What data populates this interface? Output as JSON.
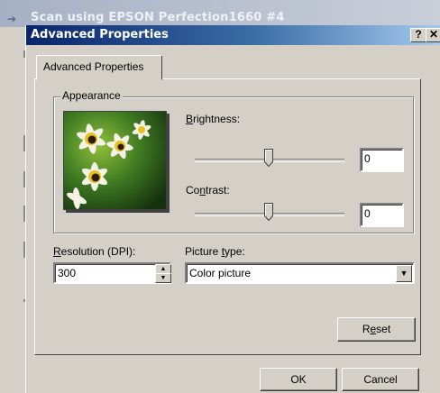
{
  "background_window": {
    "title": "Scan using EPSON Perfection1660 #4"
  },
  "dialog": {
    "title": "Advanced Properties",
    "help_label": "?",
    "close_label": "✕",
    "tab_label": "Advanced Properties",
    "appearance": {
      "legend": "Appearance",
      "brightness": {
        "label_prefix": "",
        "label_key": "B",
        "label_rest": "rightness:",
        "value": "0",
        "level": 0
      },
      "contrast": {
        "label_prefix": "Co",
        "label_key": "n",
        "label_rest": "trast:",
        "value": "0",
        "level": 0
      }
    },
    "resolution": {
      "label_key": "R",
      "label_rest": "esolution (DPI):",
      "value": "300"
    },
    "picture_type": {
      "label_prefix": "Picture ",
      "label_key": "t",
      "label_rest": "ype:",
      "value": "Color picture"
    },
    "reset_prefix": "R",
    "reset_key": "e",
    "reset_rest": "set",
    "ok_label": "OK",
    "cancel_label": "Cancel"
  },
  "colors": {
    "titlebar_start": "#0a246a",
    "titlebar_end": "#a6caf0",
    "face": "#d4d0c8"
  },
  "icons": [
    "scanner-icon",
    "help-icon",
    "close-icon",
    "spin-up-icon",
    "spin-down-icon",
    "chevron-down-icon"
  ]
}
